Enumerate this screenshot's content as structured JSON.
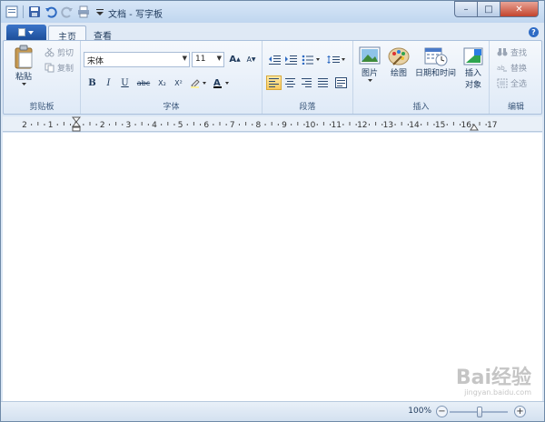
{
  "window": {
    "title": "文档 - 写字板",
    "controls": {
      "minimize": "–",
      "maximize": "□",
      "close": "✕"
    }
  },
  "qat": {
    "icons": [
      "app-icon",
      "save-icon",
      "undo-icon",
      "redo-icon",
      "print-icon",
      "customize-icon"
    ]
  },
  "tabs": [
    {
      "label": "主页",
      "active": true
    },
    {
      "label": "查看",
      "active": false
    }
  ],
  "help_label": "?",
  "ribbon": {
    "clipboard": {
      "label": "剪贴板",
      "paste": "粘贴",
      "cut": "剪切",
      "copy": "复制"
    },
    "font": {
      "label": "字体",
      "family": "宋体",
      "size": "11",
      "grow": "A",
      "shrink": "A",
      "bold": "B",
      "italic": "I",
      "underline": "U",
      "strike": "abc",
      "subscript": "X₂",
      "superscript": "X²"
    },
    "paragraph": {
      "label": "段落"
    },
    "insert": {
      "label": "插入",
      "picture": "图片",
      "paint": "绘图",
      "datetime": "日期和时间",
      "object_line1": "插入",
      "object_line2": "对象"
    },
    "editing": {
      "label": "编辑",
      "find": "查找",
      "replace": "替换",
      "select_all": "全选"
    }
  },
  "ruler": {
    "numbers": [
      "2",
      "1",
      "1",
      "2",
      "3",
      "4",
      "5",
      "6",
      "7",
      "8",
      "9",
      "10",
      "11",
      "12",
      "13",
      "14",
      "15",
      "16",
      "17"
    ]
  },
  "status": {
    "zoom": "100%",
    "zoom_out": "−",
    "zoom_in": "+"
  },
  "watermark": {
    "text": "Bai经验",
    "sub": "jingyan.baidu.com"
  },
  "colors": {
    "accent": "#2f6cc5",
    "close": "#c3442d",
    "ribbon_bg": "#dfeaf7",
    "active_button": "#f9c95d"
  }
}
